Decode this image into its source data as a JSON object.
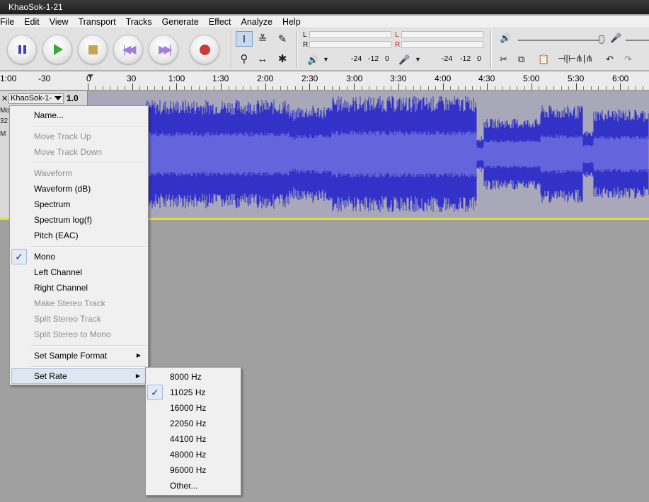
{
  "window": {
    "title": "KhaoSok-1-21"
  },
  "menubar": [
    "File",
    "Edit",
    "View",
    "Transport",
    "Tracks",
    "Generate",
    "Effect",
    "Analyze",
    "Help"
  ],
  "meters": {
    "playback": {
      "l": "L",
      "r": "R",
      "ticks": [
        "-24",
        "-12",
        "0"
      ]
    },
    "record": {
      "l": "L",
      "r": "R",
      "ticks": [
        "-24",
        "-12",
        "0"
      ]
    }
  },
  "timeline": {
    "labels": [
      "1:00",
      "-30",
      "0",
      "30",
      "1:00",
      "1:30",
      "2:00",
      "2:30",
      "3:00",
      "3:30",
      "4:00",
      "4:30",
      "5:00",
      "5:30",
      "6:00"
    ]
  },
  "track": {
    "close": "✕",
    "name": "KhaoSok-1-",
    "scale_top": "1.0",
    "side_fragments": [
      "Mo",
      "32",
      "M"
    ]
  },
  "context_menu": {
    "items": [
      {
        "label": "Name...",
        "state": "enabled"
      },
      {
        "label": "Move Track Up",
        "state": "disabled"
      },
      {
        "label": "Move Track Down",
        "state": "disabled"
      },
      {
        "label": "Waveform",
        "state": "disabled"
      },
      {
        "label": "Waveform (dB)",
        "state": "enabled"
      },
      {
        "label": "Spectrum",
        "state": "enabled"
      },
      {
        "label": "Spectrum log(f)",
        "state": "enabled"
      },
      {
        "label": "Pitch (EAC)",
        "state": "enabled"
      },
      {
        "label": "Mono",
        "state": "checked"
      },
      {
        "label": "Left Channel",
        "state": "enabled"
      },
      {
        "label": "Right Channel",
        "state": "enabled"
      },
      {
        "label": "Make Stereo Track",
        "state": "disabled"
      },
      {
        "label": "Split Stereo Track",
        "state": "disabled"
      },
      {
        "label": "Split Stereo to Mono",
        "state": "disabled"
      },
      {
        "label": "Set Sample Format",
        "state": "submenu"
      },
      {
        "label": "Set Rate",
        "state": "submenu-open"
      }
    ]
  },
  "rate_submenu": {
    "items": [
      {
        "label": "8000 Hz",
        "checked": false
      },
      {
        "label": "11025 Hz",
        "checked": true
      },
      {
        "label": "16000 Hz",
        "checked": false
      },
      {
        "label": "22050 Hz",
        "checked": false
      },
      {
        "label": "44100 Hz",
        "checked": false
      },
      {
        "label": "48000 Hz",
        "checked": false
      },
      {
        "label": "96000 Hz",
        "checked": false
      },
      {
        "label": "Other...",
        "checked": false
      }
    ]
  },
  "icons": {
    "check": "✓",
    "submenu_arrow": "▶",
    "speaker": "🔊",
    "mic": "🎤"
  },
  "colors": {
    "waveform_peak": "#3232c8",
    "waveform_rms": "#6464dc",
    "track_bg": "#a8a8b8",
    "selection_line": "#dede3c"
  }
}
